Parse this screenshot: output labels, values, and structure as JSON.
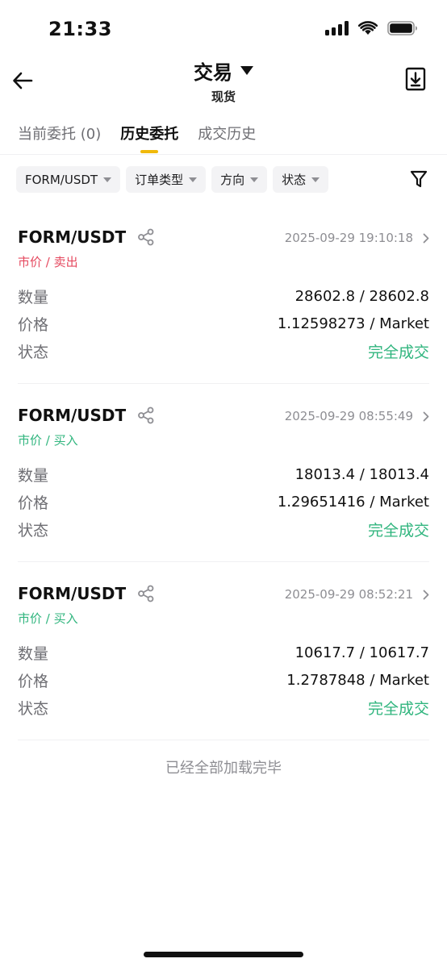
{
  "status_bar": {
    "time": "21:33"
  },
  "header": {
    "title": "交易",
    "subtitle": "现货"
  },
  "tabs": [
    {
      "label": "当前委托 (0)",
      "active": false
    },
    {
      "label": "历史委托",
      "active": true
    },
    {
      "label": "成交历史",
      "active": false
    }
  ],
  "filters": [
    "FORM/USDT",
    "订单类型",
    "方向",
    "状态"
  ],
  "labels": {
    "quantity": "数量",
    "price": "价格",
    "status": "状态"
  },
  "orders": [
    {
      "pair": "FORM/USDT",
      "time": "2025-09-29 19:10:18",
      "side": "市价 / 卖出",
      "side_type": "sell",
      "quantity": "28602.8 / 28602.8",
      "price": "1.12598273 / Market",
      "status": "完全成交"
    },
    {
      "pair": "FORM/USDT",
      "time": "2025-09-29 08:55:49",
      "side": "市价 / 买入",
      "side_type": "buy",
      "quantity": "18013.4 / 18013.4",
      "price": "1.29651416 / Market",
      "status": "完全成交"
    },
    {
      "pair": "FORM/USDT",
      "time": "2025-09-29 08:52:21",
      "side": "市价 / 买入",
      "side_type": "buy",
      "quantity": "10617.7 / 10617.7",
      "price": "1.2787848 / Market",
      "status": "完全成交"
    }
  ],
  "footer": {
    "end_message": "已经全部加载完毕"
  },
  "colors": {
    "sell": "#e5495f",
    "buy": "#30b57e",
    "accent": "#f0b90b",
    "muted": "#8e8e93"
  },
  "icons": [
    "back-arrow-icon",
    "dropdown-caret-icon",
    "download-icon",
    "filter-icon",
    "share-icon",
    "chevron-right-icon",
    "signal-icon",
    "wifi-icon",
    "battery-icon"
  ]
}
